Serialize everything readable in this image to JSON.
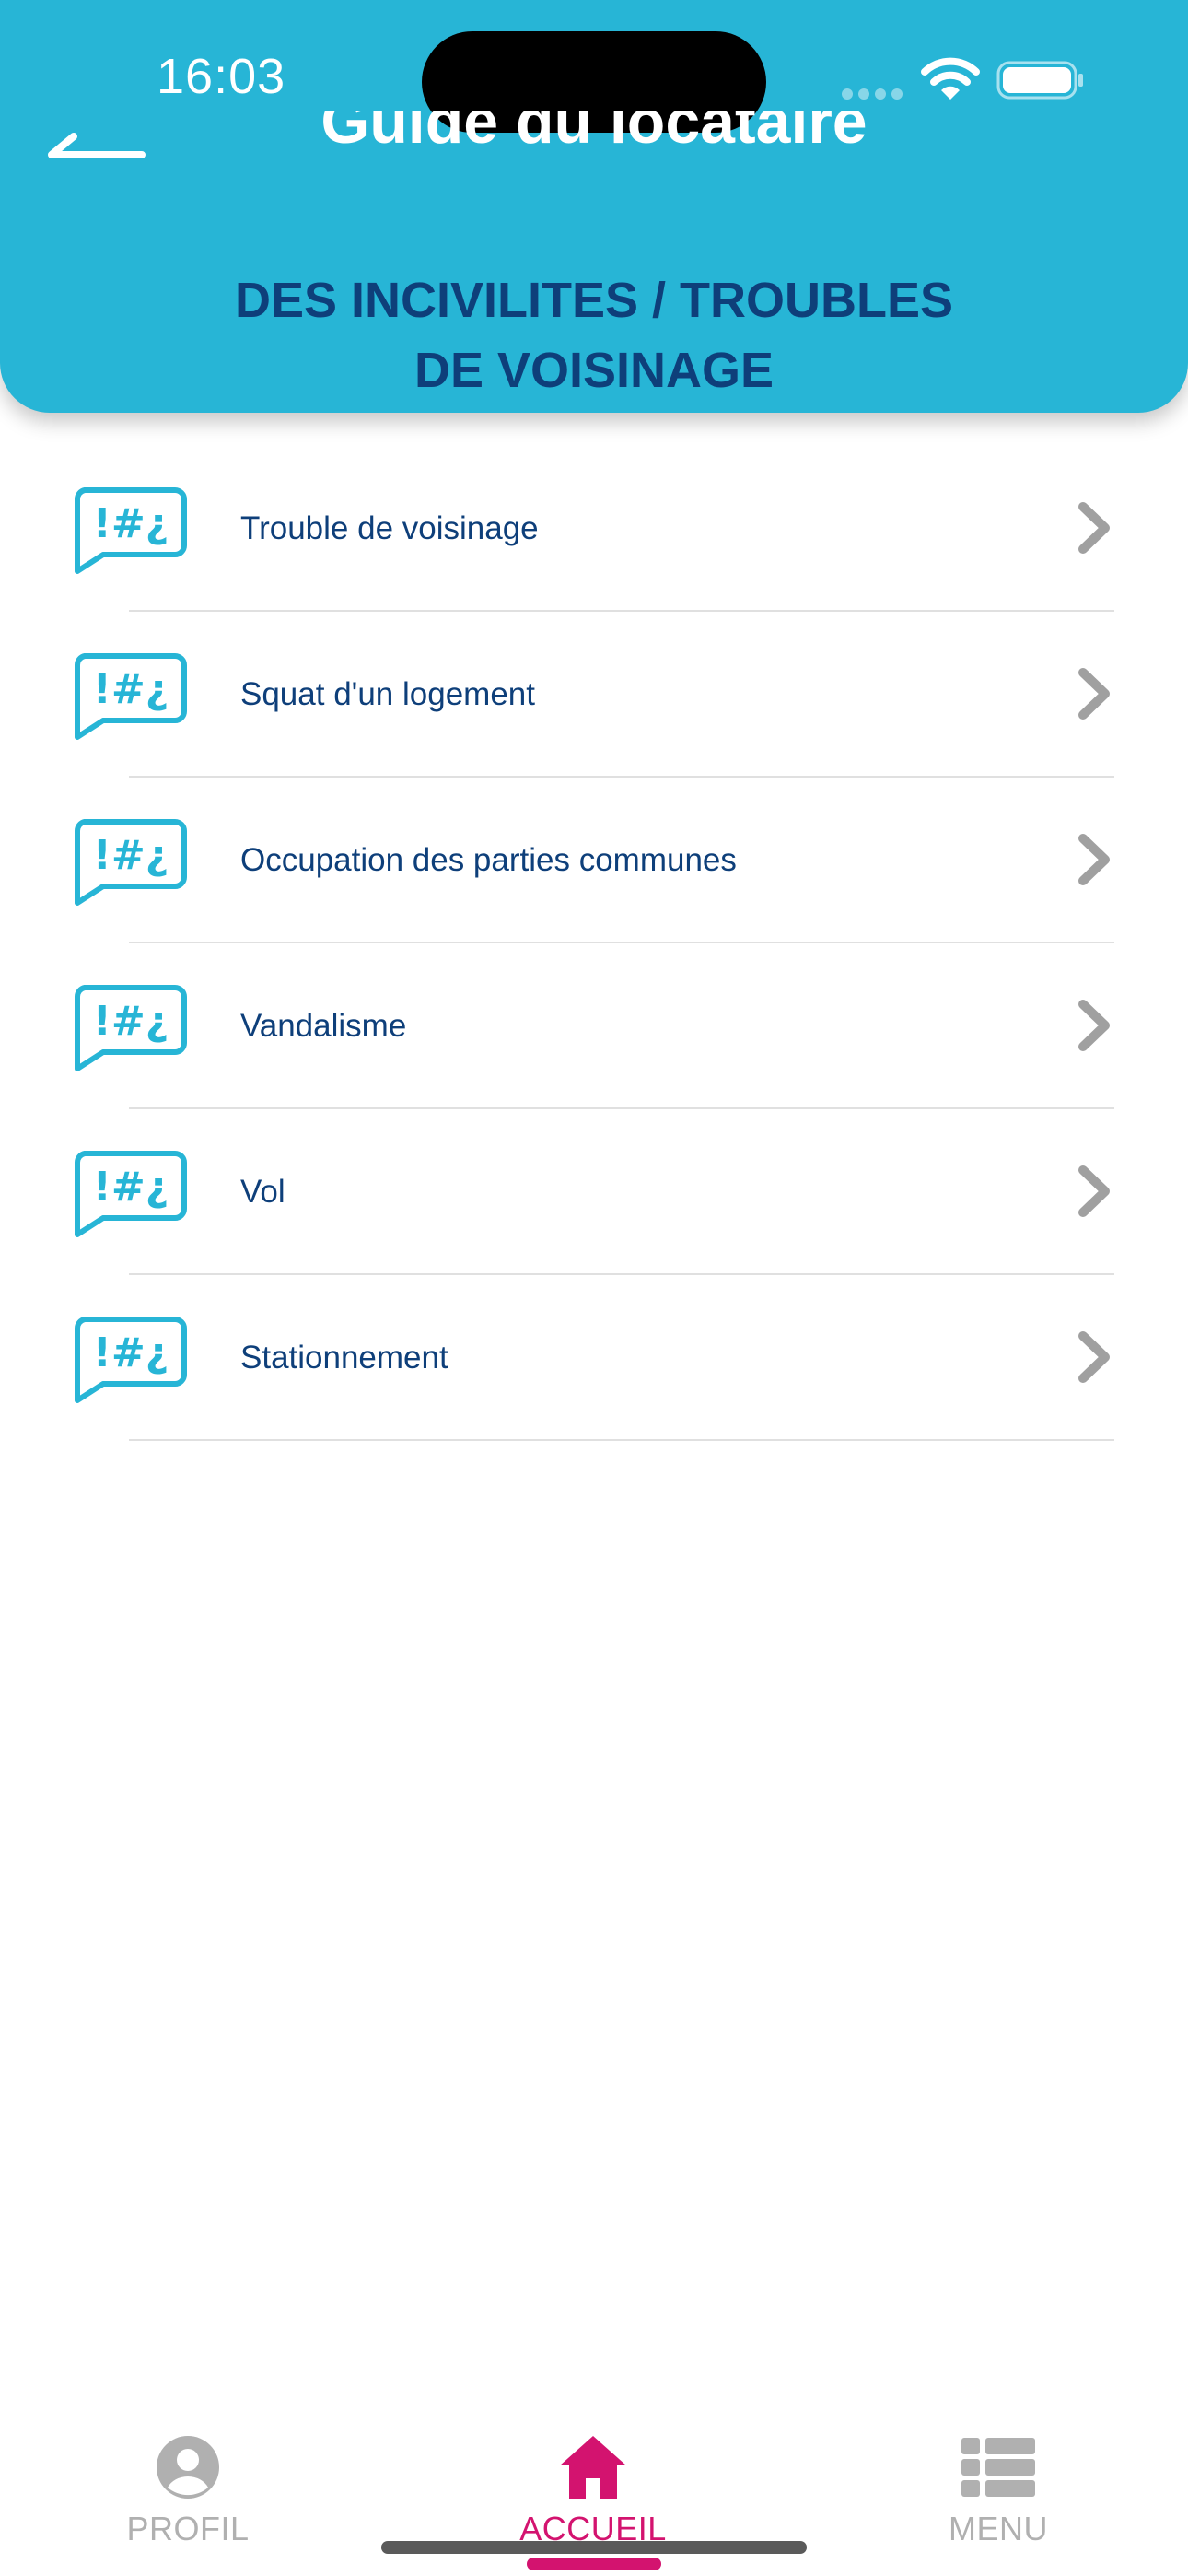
{
  "status_bar": {
    "time": "16:03"
  },
  "header": {
    "title": "Guide du locataire",
    "section_line1": "DES INCIVILITES / TROUBLES",
    "section_line2": "DE VOISINAGE"
  },
  "list": {
    "items": [
      {
        "label": "Trouble de voisinage",
        "icon": "speech-bubble-symbols-icon"
      },
      {
        "label": "Squat d'un logement",
        "icon": "speech-bubble-symbols-icon"
      },
      {
        "label": "Occupation des parties communes",
        "icon": "speech-bubble-symbols-icon"
      },
      {
        "label": "Vandalisme",
        "icon": "speech-bubble-symbols-icon"
      },
      {
        "label": "Vol",
        "icon": "speech-bubble-symbols-icon"
      },
      {
        "label": "Stationnement",
        "icon": "speech-bubble-symbols-icon"
      }
    ]
  },
  "tabbar": {
    "profil": "PROFIL",
    "accueil": "ACCUEIL",
    "menu": "MENU",
    "active": "accueil"
  },
  "colors": {
    "header_bg": "#27b5d6",
    "text_navy": "#0e3f7a",
    "accent_pink": "#d3136f",
    "icon_cyan": "#27b5d6",
    "inactive_gray": "#b0b0b0"
  }
}
